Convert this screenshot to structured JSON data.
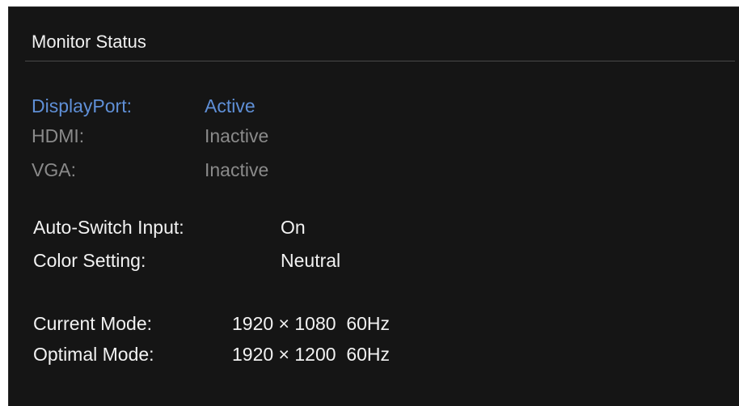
{
  "panel": {
    "title": "Monitor Status"
  },
  "inputs": [
    {
      "label": "DisplayPort:",
      "value": "Active",
      "state": "active"
    },
    {
      "label": "HDMI:",
      "value": "Inactive",
      "state": "inactive"
    },
    {
      "label": "VGA:",
      "value": "Inactive",
      "state": "inactive"
    }
  ],
  "settings": {
    "auto_switch": {
      "label": "Auto-Switch Input:",
      "value": "On"
    },
    "color_setting": {
      "label": "Color Setting:",
      "value": "Neutral"
    }
  },
  "modes": {
    "current": {
      "label": "Current Mode:",
      "value": "1920 × 1080  60Hz"
    },
    "optimal": {
      "label": "Optimal Mode:",
      "value": "1920 × 1200  60Hz"
    }
  },
  "colors": {
    "background": "#151515",
    "active": "#5f8fd6",
    "inactive": "#8a8a8a",
    "text": "#f2f2f2"
  }
}
